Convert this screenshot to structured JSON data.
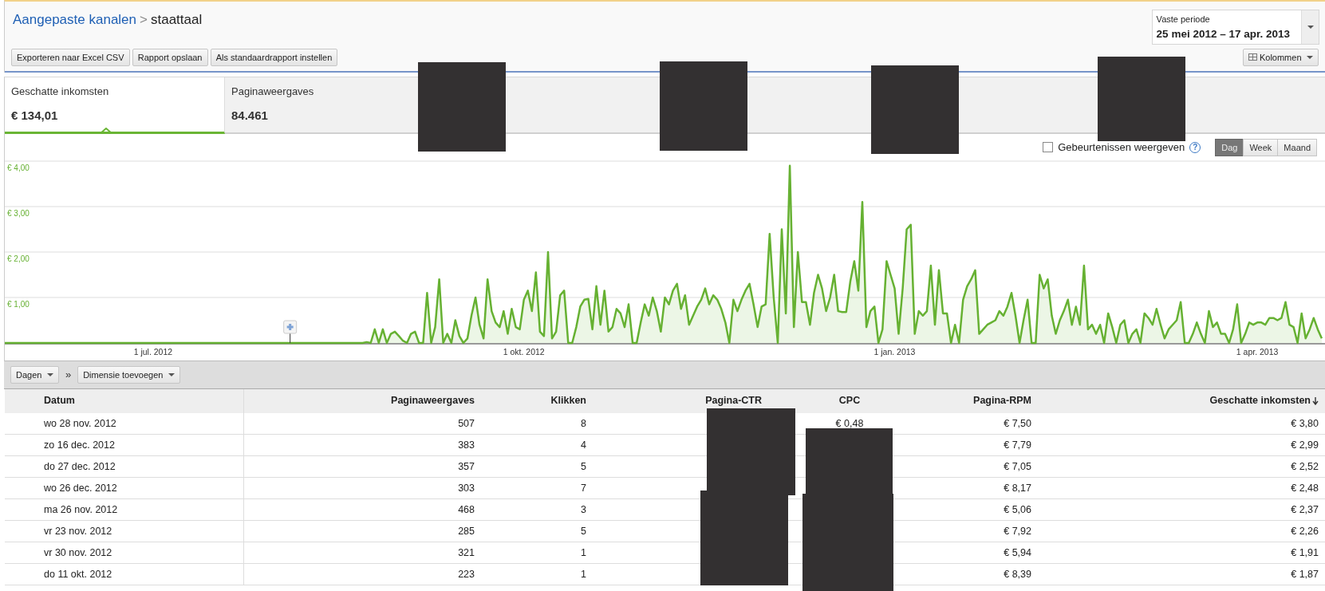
{
  "breadcrumb": {
    "parent": "Aangepaste kanalen",
    "separator": ">",
    "current": "staattaal"
  },
  "period": {
    "label": "Vaste periode",
    "range": "25 mei 2012 – 17 apr. 2013"
  },
  "actions": [
    "Exporteren naar Excel CSV",
    "Rapport opslaan",
    "Als standaardrapport instellen"
  ],
  "columns_button": "Kolommen",
  "metrics": [
    {
      "label": "Geschatte inkomsten",
      "value": "€ 134,01",
      "selected": true
    },
    {
      "label": "Paginaweergaves",
      "value": "84.461",
      "selected": false
    }
  ],
  "events_toggle": {
    "label": "Gebeurtenissen weergeven",
    "checked": false,
    "help": "?"
  },
  "granularity": [
    {
      "label": "Dag",
      "selected": true
    },
    {
      "label": "Week",
      "selected": false
    },
    {
      "label": "Maand",
      "selected": false
    }
  ],
  "chart": {
    "chart_data": {
      "type": "area",
      "grid": true,
      "ylim": [
        0,
        4
      ],
      "yticks": [
        {
          "value": 1,
          "label": "€ 1,00"
        },
        {
          "value": 2,
          "label": "€ 2,00"
        },
        {
          "value": 3,
          "label": "€ 3,00"
        },
        {
          "value": 4,
          "label": "€ 4,00"
        }
      ],
      "categories": [
        null,
        null,
        null,
        null,
        null,
        null,
        null,
        null,
        null,
        null,
        null,
        null,
        null,
        null,
        null,
        null,
        null,
        null,
        null,
        null,
        null,
        null,
        null,
        null,
        null,
        null,
        null,
        null,
        null,
        null,
        null,
        null,
        null,
        null,
        null,
        null,
        null,
        "1 jul. 2012",
        null,
        null,
        null,
        null,
        null,
        null,
        null,
        null,
        null,
        null,
        null,
        null,
        null,
        null,
        null,
        null,
        null,
        null,
        null,
        null,
        null,
        null,
        null,
        null,
        null,
        null,
        null,
        null,
        null,
        null,
        null,
        null,
        null,
        null,
        null,
        null,
        null,
        null,
        null,
        null,
        null,
        null,
        null,
        null,
        null,
        null,
        null,
        null,
        null,
        null,
        null,
        null,
        null,
        null,
        null,
        null,
        null,
        null,
        null,
        null,
        null,
        null,
        null,
        null,
        null,
        null,
        null,
        null,
        null,
        null,
        null,
        null,
        null,
        null,
        null,
        null,
        null,
        null,
        null,
        null,
        null,
        null,
        null,
        null,
        null,
        null,
        null,
        null,
        null,
        null,
        null,
        "1 okt. 2012",
        null,
        null,
        null,
        null,
        null,
        null,
        null,
        null,
        null,
        null,
        null,
        null,
        null,
        null,
        null,
        null,
        null,
        null,
        null,
        null,
        null,
        null,
        null,
        null,
        null,
        null,
        null,
        null,
        null,
        null,
        null,
        null,
        null,
        null,
        null,
        null,
        null,
        null,
        null,
        null,
        null,
        null,
        null,
        null,
        null,
        null,
        null,
        null,
        null,
        null,
        null,
        null,
        null,
        null,
        null,
        null,
        null,
        null,
        null,
        null,
        null,
        null,
        null,
        null,
        null,
        null,
        null,
        null,
        null,
        null,
        null,
        null,
        null,
        null,
        null,
        null,
        null,
        null,
        null,
        null,
        null,
        null,
        null,
        null,
        null,
        null,
        null,
        null,
        null,
        null,
        null,
        "1 jan. 2013",
        null,
        null,
        null,
        null,
        null,
        null,
        null,
        null,
        null,
        null,
        null,
        null,
        null,
        null,
        null,
        null,
        null,
        null,
        null,
        null,
        null,
        null,
        null,
        null,
        null,
        null,
        null,
        null,
        null,
        null,
        null,
        null,
        null,
        null,
        null,
        null,
        null,
        null,
        null,
        null,
        null,
        null,
        null,
        null,
        null,
        null,
        null,
        null,
        null,
        null,
        null,
        null,
        null,
        null,
        null,
        null,
        null,
        null,
        null,
        null,
        null,
        null,
        null,
        null,
        null,
        null,
        null,
        null,
        null,
        null,
        null,
        null,
        null,
        null,
        null,
        null,
        null,
        null,
        null,
        null,
        null,
        null,
        null,
        null,
        null,
        null,
        null,
        null,
        null,
        "1 apr. 2013",
        null,
        null,
        null,
        null,
        null,
        null,
        null,
        null,
        null,
        null,
        null,
        null,
        null,
        null,
        null,
        null
      ],
      "series": [
        {
          "color": "#66b132",
          "values": [
            0,
            0,
            0,
            0,
            0,
            0,
            0,
            0,
            0,
            0,
            0,
            0,
            0,
            0,
            0,
            0,
            0,
            0,
            0,
            0,
            0,
            0,
            0,
            0,
            0,
            0,
            0,
            0,
            0,
            0,
            0,
            0,
            0,
            0,
            0,
            0,
            0,
            0,
            0,
            0,
            0,
            0,
            0,
            0,
            0,
            0,
            0,
            0,
            0,
            0,
            0,
            0,
            0,
            0,
            0,
            0,
            0,
            0,
            0,
            0,
            0,
            0,
            0,
            0,
            0,
            0,
            0,
            0,
            0,
            0,
            0,
            0,
            0,
            0,
            0,
            0,
            0,
            0,
            0,
            0,
            0,
            0,
            0,
            0,
            0,
            0,
            0,
            0,
            0,
            0,
            0.02,
            0,
            0.3,
            0,
            0.3,
            0,
            0.2,
            0.25,
            0.15,
            0.05,
            0,
            0.2,
            0.25,
            0,
            0,
            1.1,
            0,
            0.35,
            1.4,
            0,
            0.2,
            0,
            0.5,
            0.15,
            0,
            0.1,
            0.6,
            1.0,
            0.4,
            0.1,
            1.4,
            0.7,
            0.45,
            0.35,
            0.7,
            0.2,
            0.75,
            0.35,
            0.3,
            0.95,
            1.15,
            0.7,
            1.55,
            0.25,
            0.15,
            2.0,
            0.1,
            0.25,
            1.05,
            1.15,
            0,
            0,
            0.35,
            0.8,
            0.95,
            0.97,
            0.3,
            1.25,
            0.4,
            1.15,
            0.25,
            0.35,
            0.75,
            0.65,
            0.35,
            0.85,
            0,
            0,
            0.45,
            0.85,
            0.6,
            1.0,
            0.7,
            0.25,
            1.0,
            0.85,
            1.15,
            1.3,
            0.75,
            1.05,
            0.4,
            0.6,
            0.8,
            0.95,
            1.2,
            0.85,
            1.05,
            0.95,
            0.75,
            0.45,
            0,
            0.95,
            0.7,
            0.95,
            1.15,
            1.3,
            0.85,
            0.35,
            0.8,
            0.85,
            2.4,
            1.0,
            0,
            2.5,
            0.65,
            3.9,
            0.35,
            2.0,
            0.9,
            0.9,
            0.4,
            1.1,
            1.5,
            1.2,
            0.7,
            1.0,
            1.5,
            0.7,
            0.68,
            0.68,
            1.35,
            1.8,
            1.15,
            3.1,
            0.35,
            0.7,
            0.8,
            0,
            0.3,
            1.8,
            1.5,
            1.2,
            0.2,
            1.2,
            2.5,
            2.6,
            0.2,
            0.7,
            0.6,
            0.7,
            1.7,
            0.4,
            1.6,
            0.65,
            0.65,
            0,
            0.4,
            0,
            0.95,
            1.25,
            1.4,
            1.6,
            0.2,
            0.3,
            0.4,
            0.45,
            0.5,
            0.7,
            0.6,
            0.8,
            1.1,
            0.6,
            0,
            0.5,
            0.95,
            0,
            0,
            1.5,
            1.2,
            1.4,
            0.6,
            0.2,
            0.5,
            0.7,
            0.95,
            0.4,
            0.8,
            0.4,
            1.7,
            0.3,
            0.4,
            0.2,
            0.4,
            0,
            0.65,
            0.35,
            0,
            0.4,
            0.5,
            0,
            0.2,
            0.3,
            0,
            0.65,
            0.55,
            0.4,
            0.75,
            0.4,
            0.1,
            0.3,
            0.4,
            0.5,
            0.9,
            0,
            0,
            0.2,
            0.45,
            0.2,
            0,
            0.7,
            0.35,
            0.45,
            0.2,
            0.2,
            0,
            0.3,
            0.85,
            0,
            0.2,
            0.45,
            0.4,
            0.45,
            0.45,
            0.4,
            0.55,
            0.55,
            0.5,
            0.55,
            0.9,
            0.4,
            0.35,
            0,
            0.65,
            0.1,
            0.3,
            0.55,
            0.3,
            0.1
          ]
        }
      ]
    }
  },
  "dimension_bar": {
    "dimension": "Dagen",
    "separator": "»",
    "add": "Dimensie toevoegen"
  },
  "table": {
    "columns": [
      {
        "label": "Datum",
        "sorted": false
      },
      {
        "label": "Paginaweergaves",
        "sorted": false
      },
      {
        "label": "Klikken",
        "sorted": false
      },
      {
        "label": "Pagina-CTR",
        "sorted": false
      },
      {
        "label": "CPC",
        "sorted": false
      },
      {
        "label": "Pagina-RPM",
        "sorted": false
      },
      {
        "label": "Geschatte inkomsten",
        "sorted": true
      }
    ],
    "rows": [
      {
        "date": "wo 28 nov. 2012",
        "pageviews": "507",
        "clicks": "8",
        "cpc": "€ 0,48",
        "rpm": "€ 7,50",
        "earnings": "€ 3,80"
      },
      {
        "date": "zo 16 dec. 2012",
        "pageviews": "383",
        "clicks": "4",
        "rpm": "€ 7,79",
        "earnings": "€ 2,99"
      },
      {
        "date": "do 27 dec. 2012",
        "pageviews": "357",
        "clicks": "5",
        "rpm": "€ 7,05",
        "earnings": "€ 2,52"
      },
      {
        "date": "wo 26 dec. 2012",
        "pageviews": "303",
        "clicks": "7",
        "rpm": "€ 8,17",
        "earnings": "€ 2,48"
      },
      {
        "date": "ma 26 nov. 2012",
        "pageviews": "468",
        "clicks": "3",
        "rpm": "€ 5,06",
        "earnings": "€ 2,37"
      },
      {
        "date": "vr 23 nov. 2012",
        "pageviews": "285",
        "clicks": "5",
        "rpm": "€ 7,92",
        "earnings": "€ 2,26"
      },
      {
        "date": "vr 30 nov. 2012",
        "pageviews": "321",
        "clicks": "1",
        "rpm": "€ 5,94",
        "earnings": "€ 1,91"
      },
      {
        "date": "do 11 okt. 2012",
        "pageviews": "223",
        "clicks": "1",
        "rpm": "€ 8,39",
        "earnings": "€ 1,87"
      }
    ]
  }
}
